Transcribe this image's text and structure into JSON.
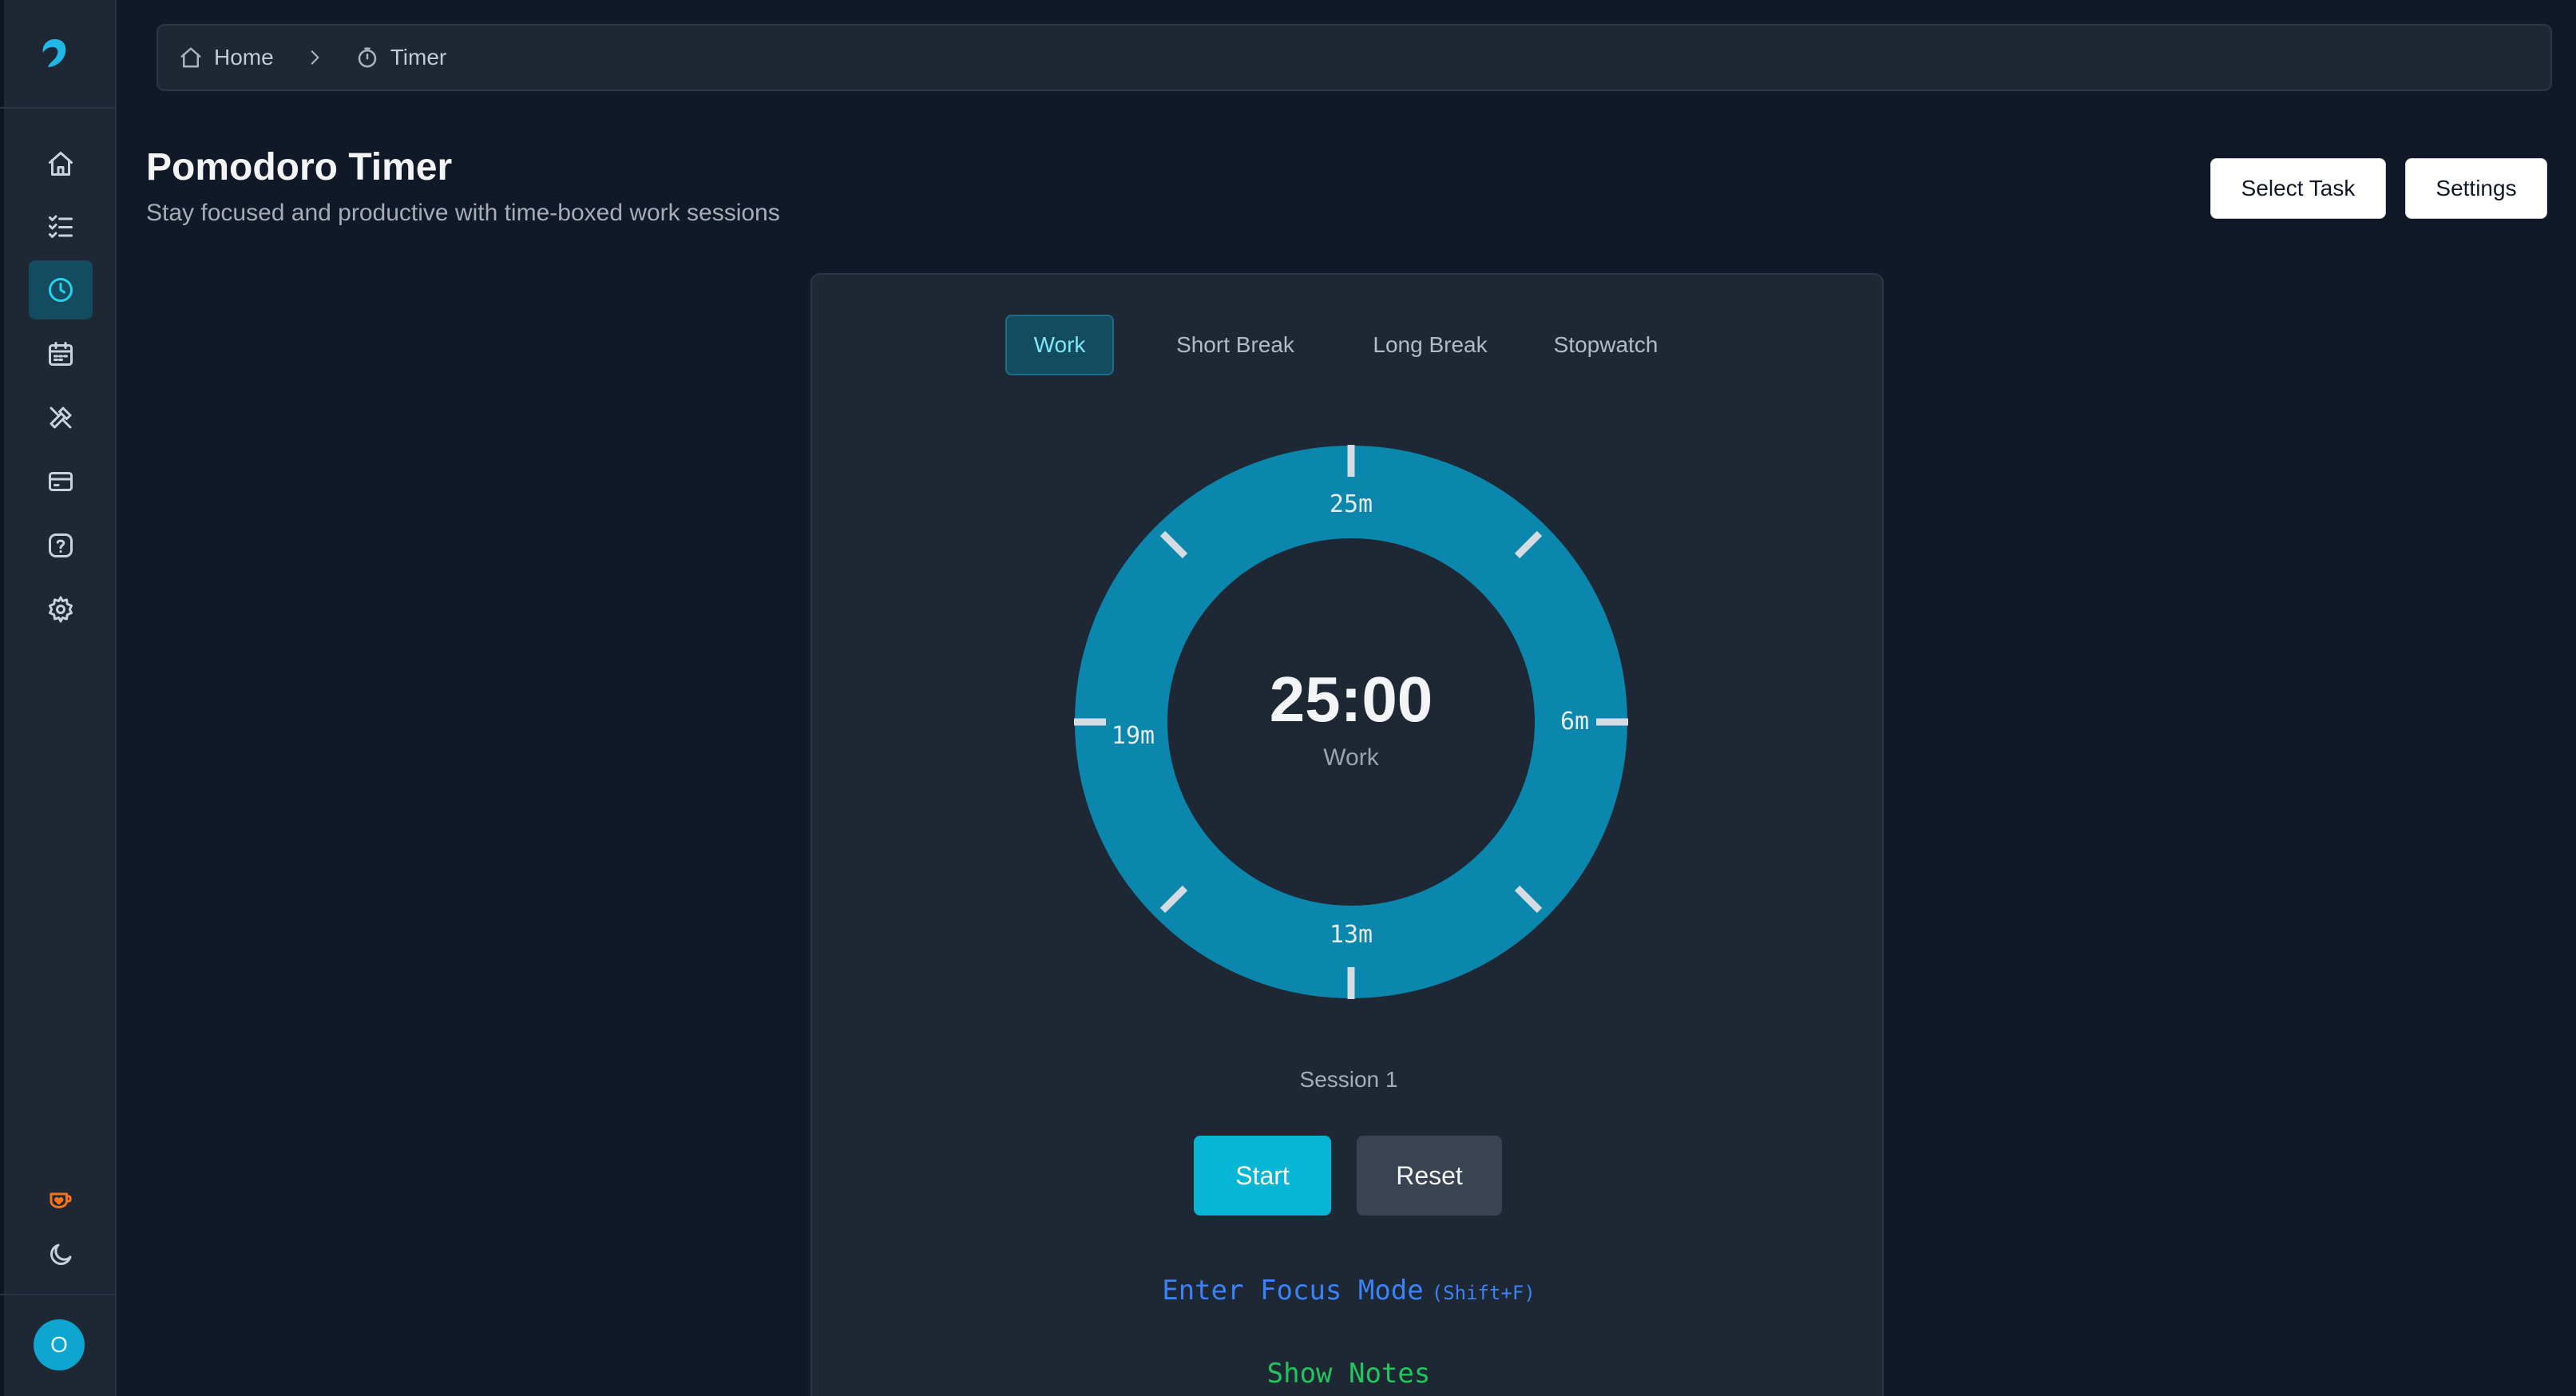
{
  "sidebar": {
    "items": [
      {
        "name": "home-icon"
      },
      {
        "name": "tasks-icon"
      },
      {
        "name": "clock-icon",
        "active": true
      },
      {
        "name": "calendar-icon"
      },
      {
        "name": "tools-icon"
      },
      {
        "name": "card-icon"
      },
      {
        "name": "help-icon"
      },
      {
        "name": "gear-icon"
      }
    ],
    "bottom": [
      {
        "name": "coffee-heart-icon"
      },
      {
        "name": "moon-icon"
      }
    ],
    "avatar_initial": "O"
  },
  "breadcrumb": {
    "home": "Home",
    "current": "Timer"
  },
  "header": {
    "title": "Pomodoro Timer",
    "subtitle": "Stay focused and productive with time-boxed work sessions",
    "select_task": "Select Task",
    "settings": "Settings"
  },
  "timer": {
    "tabs": [
      "Work",
      "Short Break",
      "Long Break",
      "Stopwatch"
    ],
    "active_tab": "Work",
    "time": "25:00",
    "mode_label": "Work",
    "ring_labels": {
      "top": "25m",
      "right": "6m",
      "bottom": "13m",
      "left": "19m"
    },
    "progress": 1.0,
    "session": "Session 1",
    "start": "Start",
    "reset": "Reset",
    "focus_mode": "Enter Focus Mode",
    "focus_shortcut": "(Shift+F)",
    "show_notes": "Show Notes"
  },
  "colors": {
    "accent": "#06b6d4",
    "ring": "#0b86ad",
    "background": "#111827",
    "panel": "#1e2734",
    "focus_link": "#3b82f6",
    "notes_link": "#22c55e"
  }
}
